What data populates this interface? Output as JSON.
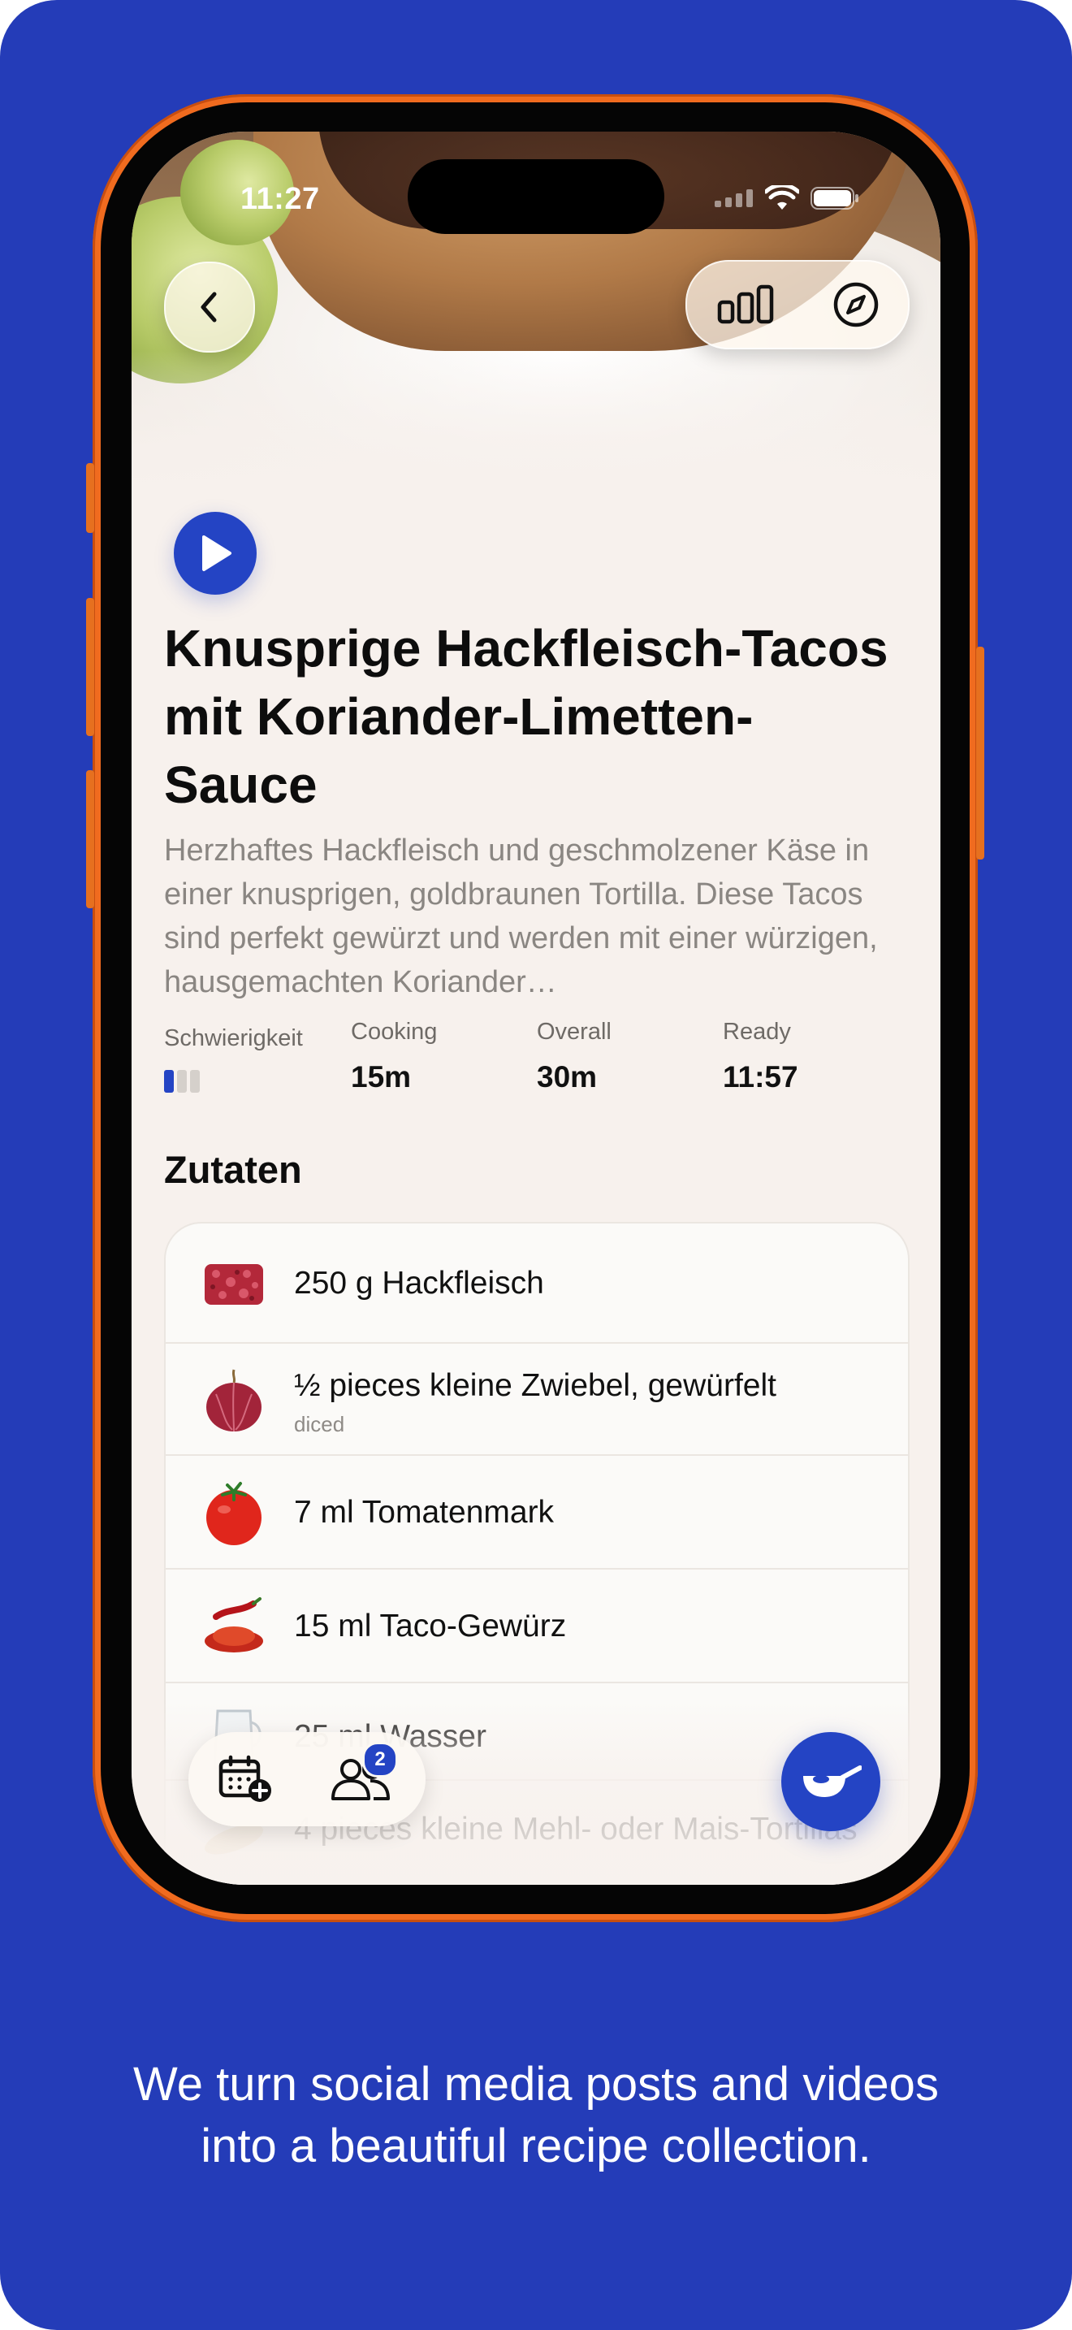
{
  "status_bar": {
    "time": "11:27"
  },
  "recipe": {
    "title": "Knusprige Hackfleisch-Tacos mit Koriander-Limetten-Sauce",
    "description": "Herzhaftes Hackfleisch und geschmolzener Käse in einer knusprigen, goldbraunen Tortilla. Diese Tacos sind perfekt gewürzt und werden mit einer würzigen, hausgemachten Koriander…",
    "stats": {
      "difficulty_label": "Schwierigkeit",
      "difficulty_level": 1,
      "difficulty_max": 3,
      "cooking_label": "Cooking",
      "cooking_value": "15m",
      "overall_label": "Overall",
      "overall_value": "30m",
      "ready_label": "Ready",
      "ready_value": "11:57"
    }
  },
  "ingredients": {
    "title": "Zutaten",
    "items": [
      {
        "name": "250 g Hackfleisch",
        "note": "",
        "icon": "ground-meat-icon"
      },
      {
        "name": "½ pieces kleine Zwiebel, gewürfelt",
        "note": "diced",
        "icon": "onion-icon"
      },
      {
        "name": "7 ml Tomatenmark",
        "note": "",
        "icon": "tomato-icon"
      },
      {
        "name": "15 ml Taco-Gewürz",
        "note": "",
        "icon": "spice-icon"
      },
      {
        "name": "25 ml Wasser",
        "note": "",
        "icon": "water-icon"
      },
      {
        "name": "4 pieces kleine Mehl- oder Mais-Tortillas",
        "note": "",
        "icon": "tortilla-icon"
      }
    ]
  },
  "dock": {
    "household_badge": "2"
  },
  "tagline": {
    "line1": "We turn social media posts and videos",
    "line2": "into a beautiful recipe collection."
  },
  "colors": {
    "background": "#243cb8",
    "accent": "#2444c4",
    "phone_frame": "#f06b1f",
    "screen_bg": "#f7f1ed"
  }
}
